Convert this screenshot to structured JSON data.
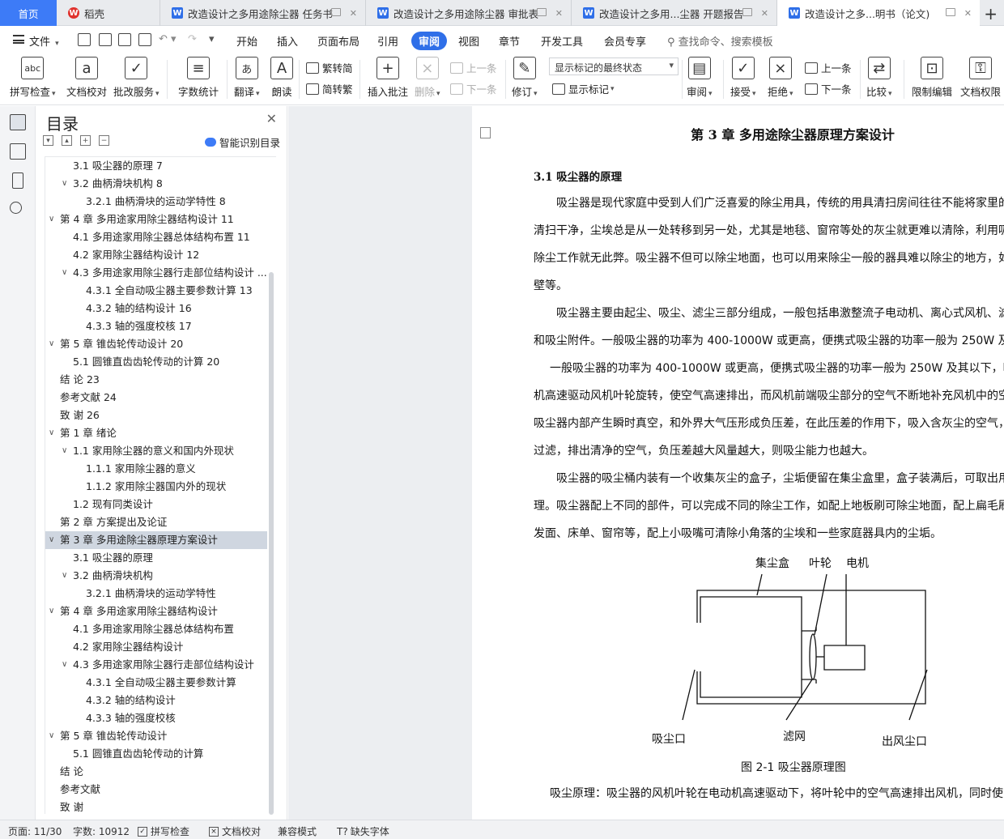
{
  "tabs": [
    {
      "label": "首页"
    },
    {
      "label": "稻壳"
    },
    {
      "label": "改造设计之多用途除尘器 任务书"
    },
    {
      "label": "改造设计之多用途除尘器 审批表"
    },
    {
      "label": "改造设计之多用...尘器 开题报告"
    },
    {
      "label": "改造设计之多...明书（论文)"
    }
  ],
  "menu": {
    "file": "文件",
    "items": [
      "开始",
      "插入",
      "页面布局",
      "引用",
      "审阅",
      "视图",
      "章节",
      "开发工具",
      "会员专享"
    ],
    "active": "审阅",
    "search": "查找命令、搜索模板"
  },
  "ribbon": {
    "spell_check": "拼写检查",
    "doc_proof": "文档校对",
    "batch_service": "批改服务",
    "word_count": "字数统计",
    "translate": "翻译",
    "read_aloud": "朗读",
    "to_traditional": "繁转简",
    "to_simplified": "简转繁",
    "insert_comment": "插入批注",
    "delete": "删除",
    "prev_comment": "上一条",
    "next_comment": "下一条",
    "track_changes": "修订",
    "markup_state": "显示标记的最终状态",
    "show_markup": "显示标记",
    "review": "审阅",
    "accept": "接受",
    "reject": "拒绝",
    "prev_change": "上一条",
    "next_change": "下一条",
    "compare": "比较",
    "restrict_edit": "限制编辑",
    "doc_permission": "文档权限"
  },
  "toc": {
    "title": "目录",
    "smart": "智能识别目录",
    "items": [
      {
        "text": "3.1 吸尘器的原理 7",
        "level": 2,
        "arrow": false
      },
      {
        "text": "3.2  曲柄滑块机构 8",
        "level": 2,
        "arrow": true
      },
      {
        "text": "3.2.1 曲柄滑块的运动学特性 8",
        "level": 3,
        "arrow": false
      },
      {
        "text": "第 4 章  多用途家用除尘器结构设计 11",
        "level": 1,
        "arrow": true
      },
      {
        "text": "4.1  多用途家用除尘器总体结构布置 11",
        "level": 2,
        "arrow": false
      },
      {
        "text": "4.2 家用除尘器结构设计 12",
        "level": 2,
        "arrow": false
      },
      {
        "text": "4.3 多用途家用除尘器行走部位结构设计  ...",
        "level": 2,
        "arrow": true
      },
      {
        "text": "4.3.1 全自动吸尘器主要参数计算 13",
        "level": 3,
        "arrow": false
      },
      {
        "text": "4.3.2 轴的结构设计 16",
        "level": 3,
        "arrow": false
      },
      {
        "text": "4.3.3 轴的强度校核 17",
        "level": 3,
        "arrow": false
      },
      {
        "text": "第 5 章  锥齿轮传动设计 20",
        "level": 1,
        "arrow": true
      },
      {
        "text": "5.1 圆锥直齿齿轮传动的计算 20",
        "level": 2,
        "arrow": false
      },
      {
        "text": "结    论 23",
        "level": 1,
        "arrow": false
      },
      {
        "text": "参考文献 24",
        "level": 1,
        "arrow": false
      },
      {
        "text": "致    谢 26",
        "level": 1,
        "arrow": false
      },
      {
        "text": "第 1 章  绪论",
        "level": 1,
        "arrow": true
      },
      {
        "text": "1.1 家用除尘器的意义和国内外现状",
        "level": 2,
        "arrow": true
      },
      {
        "text": "1.1.1 家用除尘器的意义",
        "level": 3,
        "arrow": false
      },
      {
        "text": "1.1.2 家用除尘器国内外的现状",
        "level": 3,
        "arrow": false
      },
      {
        "text": "1.2 现有同类设计",
        "level": 2,
        "arrow": false
      },
      {
        "text": "第 2 章  方案提出及论证",
        "level": 1,
        "arrow": false
      },
      {
        "text": "第 3 章  多用途除尘器原理方案设计",
        "level": 1,
        "arrow": true,
        "selected": true
      },
      {
        "text": "3.1 吸尘器的原理",
        "level": 2,
        "arrow": false
      },
      {
        "text": "3.2  曲柄滑块机构",
        "level": 2,
        "arrow": true
      },
      {
        "text": "3.2.1 曲柄滑块的运动学特性",
        "level": 3,
        "arrow": false
      },
      {
        "text": "第 4 章  多用途家用除尘器结构设计",
        "level": 1,
        "arrow": true
      },
      {
        "text": "4.1  多用途家用除尘器总体结构布置",
        "level": 2,
        "arrow": false
      },
      {
        "text": "4.2 家用除尘器结构设计",
        "level": 2,
        "arrow": false
      },
      {
        "text": "4.3 多用途家用除尘器行走部位结构设计",
        "level": 2,
        "arrow": true
      },
      {
        "text": "4.3.1 全自动吸尘器主要参数计算",
        "level": 3,
        "arrow": false
      },
      {
        "text": "4.3.2 轴的结构设计",
        "level": 3,
        "arrow": false
      },
      {
        "text": "4.3.3 轴的强度校核",
        "level": 3,
        "arrow": false
      },
      {
        "text": "第 5 章  锥齿轮传动设计",
        "level": 1,
        "arrow": true
      },
      {
        "text": "5.1 圆锥直齿齿轮传动的计算",
        "level": 2,
        "arrow": false
      },
      {
        "text": "结    论",
        "level": 1,
        "arrow": false
      },
      {
        "text": "参考文献",
        "level": 1,
        "arrow": false
      },
      {
        "text": "致    谢",
        "level": 1,
        "arrow": false
      }
    ]
  },
  "doc": {
    "chapter_title": "第 3 章  多用途除尘器原理方案设计",
    "section_title": "3.1 吸尘器的原理",
    "lines": [
      "吸尘器是现代家庭中受到人们广泛喜爱的除尘用具，传统的用具清扫房间往往不能将家里的",
      "清扫干净，尘埃总是从一处转移到另一处，尤其是地毯、窗帘等处的灰尘就更难以清除，利用吸",
      "除尘工作就无此弊。吸尘器不但可以除尘地面，也可以用来除尘一般的器具难以除尘的地方，如",
      "壁等。",
      "吸尘器主要由起尘、吸尘、滤尘三部分组成，一般包括串激整流子电动机、离心式风机、滤",
      "和吸尘附件。一般吸尘器的功率为 400-1000W 或更高，便携式吸尘器的功率一般为 250W 及其以",
      "一般吸尘器的功率为 400-1000W 或更高，便携式吸尘器的功率一般为 250W 及其以下，吸尘",
      "机高速驱动风机叶轮旋转，使空气高速排出，而风机前端吸尘部分的空气不断地补充风机中的空",
      "吸尘器内部产生瞬时真空，和外界大气压形成负压差，在此压差的作用下，吸入含灰尘的空气，",
      "过滤，排出清净的空气，负压差越大风量越大，则吸尘能力也越大。",
      "吸尘器的吸尘桶内装有一个收集灰尘的盒子，尘垢便留在集尘盒里，盒子装满后，可取出用",
      "理。吸尘器配上不同的部件，可以完成不同的除尘工作，如配上地板刷可除尘地面，配上扁毛刷",
      "发面、床单、窗帘等，配上小吸嘴可清除小角落的尘埃和一些家庭器具内的尘垢。"
    ],
    "figure_labels": {
      "dust_box": "集尘盒",
      "impeller": "叶轮",
      "motor": "电机",
      "inlet": "吸尘口",
      "filter": "滤网",
      "outlet": "出风尘口"
    },
    "figure_caption": "图 2-1  吸尘器原理图",
    "last_line": "吸尘原理：吸尘器的风机叶轮在电动机高速驱动下，将叶轮中的空气高速排出风机，同时使"
  },
  "status": {
    "page": "页面: 11/30",
    "words": "字数: 10912",
    "spell": "拼写检查",
    "proof": "文档校对",
    "compat": "兼容模式",
    "missing_font": "缺失字体"
  }
}
